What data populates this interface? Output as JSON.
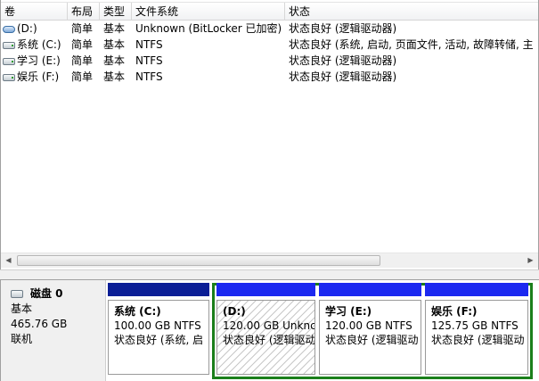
{
  "columns": {
    "volume": "卷",
    "layout": "布局",
    "type": "类型",
    "filesystem": "文件系统",
    "status": "状态"
  },
  "volumes": [
    {
      "name": "(D:)",
      "layout": "简单",
      "type": "基本",
      "filesystem": "Unknown (BitLocker 已加密)",
      "status": "状态良好 (逻辑驱动器)",
      "icon": "encrypted-drive-icon"
    },
    {
      "name": "系统 (C:)",
      "layout": "简单",
      "type": "基本",
      "filesystem": "NTFS",
      "status": "状态良好 (系统, 启动, 页面文件, 活动, 故障转储, 主",
      "icon": "drive-icon"
    },
    {
      "name": "学习 (E:)",
      "layout": "简单",
      "type": "基本",
      "filesystem": "NTFS",
      "status": "状态良好 (逻辑驱动器)",
      "icon": "drive-icon"
    },
    {
      "name": "娱乐 (F:)",
      "layout": "简单",
      "type": "基本",
      "filesystem": "NTFS",
      "status": "状态良好 (逻辑驱动器)",
      "icon": "drive-icon"
    }
  ],
  "disk": {
    "name": "磁盘 0",
    "type": "基本",
    "size": "465.76 GB",
    "state": "联机"
  },
  "partitions": [
    {
      "name": "系统 (C:)",
      "size_fs": "100.00 GB NTFS",
      "status": "状态良好 (系统, 启"
    },
    {
      "name": "(D:)",
      "size_fs": "120.00 GB Unknc",
      "status": "状态良好 (逻辑驱动"
    },
    {
      "name": "学习 (E:)",
      "size_fs": "120.00 GB NTFS",
      "status": "状态良好 (逻辑驱动"
    },
    {
      "name": "娱乐 (F:)",
      "size_fs": "125.75 GB NTFS",
      "status": "状态良好 (逻辑驱动"
    }
  ],
  "colors": {
    "primary_partition_bar": "#0b1e96",
    "logical_drive_bar": "#1b28f0",
    "extended_partition_frame": "#1b7f1b"
  }
}
